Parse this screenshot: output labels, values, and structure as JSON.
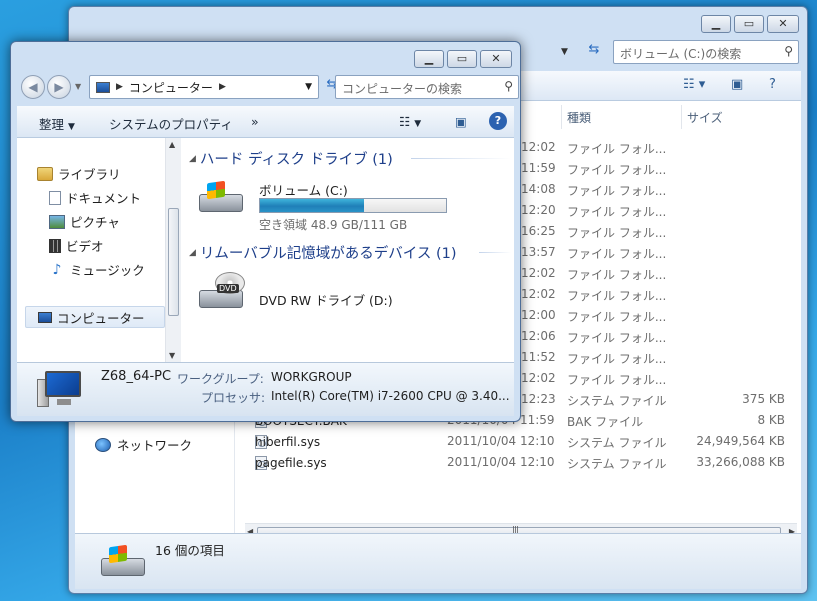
{
  "back_window": {
    "search_placeholder": "ボリューム (C:)の検索",
    "columns": {
      "type": "種類",
      "size": "サイズ"
    },
    "nav_network": "ネットワーク",
    "files": [
      {
        "name": "",
        "date": "12:02",
        "type": "ファイル フォル...",
        "size": ""
      },
      {
        "name": "",
        "date": "11:59",
        "type": "ファイル フォル...",
        "size": ""
      },
      {
        "name": "",
        "date": "14:08",
        "type": "ファイル フォル...",
        "size": ""
      },
      {
        "name": "",
        "date": "12:20",
        "type": "ファイル フォル...",
        "size": ""
      },
      {
        "name": "",
        "date": "16:25",
        "type": "ファイル フォル...",
        "size": ""
      },
      {
        "name": "",
        "date": "13:57",
        "type": "ファイル フォル...",
        "size": ""
      },
      {
        "name": "",
        "date": "12:02",
        "type": "ファイル フォル...",
        "size": ""
      },
      {
        "name": "",
        "date": "12:02",
        "type": "ファイル フォル...",
        "size": ""
      },
      {
        "name": "",
        "date": "12:00",
        "type": "ファイル フォル...",
        "size": ""
      },
      {
        "name": "",
        "date": "12:06",
        "type": "ファイル フォル...",
        "size": ""
      },
      {
        "name": "",
        "date": "11:52",
        "type": "ファイル フォル...",
        "size": ""
      },
      {
        "name": "",
        "date": "12:02",
        "type": "ファイル フォル...",
        "size": ""
      },
      {
        "name": "",
        "date": "12:23",
        "type": "システム ファイル",
        "size": "375 KB"
      },
      {
        "name": "BOOTSECT.BAK",
        "date": "2011/10/04 11:59",
        "type": "BAK ファイル",
        "size": "8 KB"
      },
      {
        "name": "hiberfil.sys",
        "date": "2011/10/04 12:10",
        "type": "システム ファイル",
        "size": "24,949,564 KB"
      },
      {
        "name": "pagefile.sys",
        "date": "2011/10/04 12:10",
        "type": "システム ファイル",
        "size": "33,266,088 KB"
      }
    ],
    "item_count": "16 個の項目"
  },
  "front_window": {
    "breadcrumb": "コンピューター",
    "search_placeholder": "コンピューターの検索",
    "toolbar": {
      "organize": "整理",
      "system_properties": "システムのプロパティ",
      "more": "»"
    },
    "nav": [
      {
        "label": "ライブラリ",
        "icon": "library-icon"
      },
      {
        "label": "ドキュメント",
        "icon": "documents-icon"
      },
      {
        "label": "ピクチャ",
        "icon": "pictures-icon"
      },
      {
        "label": "ビデオ",
        "icon": "videos-icon"
      },
      {
        "label": "ミュージック",
        "icon": "music-icon"
      },
      {
        "label": "コンピューター",
        "icon": "computer-icon"
      }
    ],
    "group_hdd": "ハード ディスク ドライブ (1)",
    "group_removable": "リムーバブル記憶域があるデバイス (1)",
    "drive_c": {
      "name": "ボリューム (C:)",
      "free_text": "空き領域 48.9 GB/111 GB",
      "used_fraction": 0.56
    },
    "drive_d": {
      "name": "DVD RW ドライブ (D:)",
      "badge": "DVD"
    },
    "details": {
      "pc_name": "Z68_64-PC",
      "workgroup_label": "ワークグループ:",
      "workgroup_value": "WORKGROUP",
      "processor_label": "プロセッサ:",
      "processor_value": "Intel(R) Core(TM) i7-2600 CPU @ 3.40..."
    }
  }
}
